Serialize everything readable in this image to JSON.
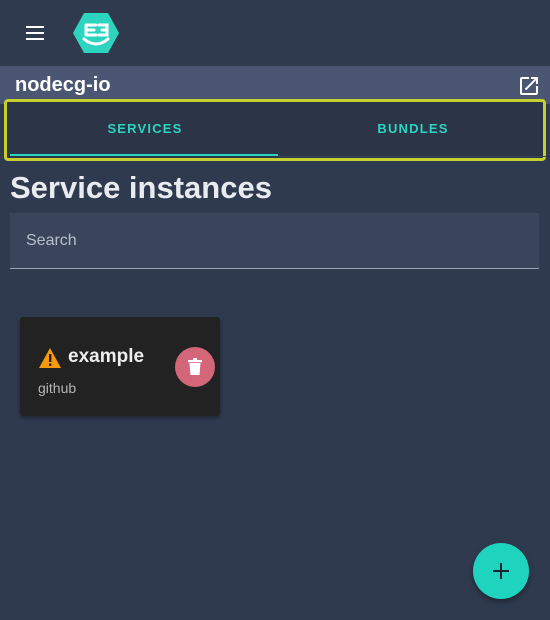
{
  "app": {
    "title": "nodecg-io",
    "logo_icon": "nodecg-logo-icon",
    "accent_color": "#2dd4c0"
  },
  "tabs": [
    {
      "label": "SERVICES",
      "active": true
    },
    {
      "label": "BUNDLES",
      "active": false
    }
  ],
  "main": {
    "heading": "Service instances",
    "search": {
      "placeholder": "Search",
      "value": ""
    }
  },
  "instances": [
    {
      "name": "example",
      "type": "github",
      "status_icon": "warning-icon",
      "delete_icon": "trash-icon"
    }
  ],
  "fab": {
    "icon": "plus-icon"
  }
}
